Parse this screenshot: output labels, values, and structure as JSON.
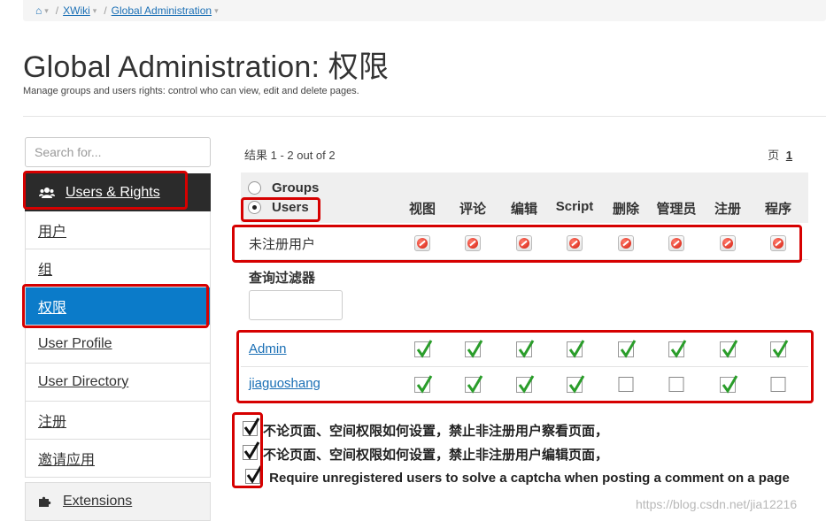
{
  "breadcrumb": {
    "home": "⌂",
    "items": [
      "XWiki",
      "Global Administration"
    ]
  },
  "page": {
    "title": "Global Administration: 权限",
    "subtitle": "Manage groups and users rights: control who can view, edit and delete pages."
  },
  "sidebar": {
    "search_placeholder": "Search for...",
    "section": "Users & Rights",
    "items": [
      "用户",
      "组",
      "权限",
      "User Profile",
      "User Directory",
      "注册",
      "邀请应用"
    ],
    "active_item": "权限",
    "extensions": "Extensions"
  },
  "main": {
    "results": "结果 1 - 2 out of 2",
    "page_label": "页",
    "page_number": "1",
    "radio_groups": "Groups",
    "radio_users": "Users",
    "selected_radio": "Users",
    "columns": [
      "视图",
      "评论",
      "编辑",
      "Script",
      "删除",
      "管理员",
      "注册",
      "程序"
    ],
    "unregistered": {
      "label": "未注册用户",
      "rights": [
        "deny",
        "deny",
        "deny",
        "deny",
        "deny",
        "deny",
        "deny",
        "deny"
      ]
    },
    "filter_label": "查询过滤器",
    "filter_value": "",
    "users": [
      {
        "name": "Admin",
        "rights": [
          "allow",
          "allow",
          "allow",
          "allow",
          "allow",
          "allow",
          "allow",
          "allow"
        ]
      },
      {
        "name": "jiaguoshang",
        "rights": [
          "allow",
          "allow",
          "allow",
          "allow",
          "none",
          "none",
          "allow",
          "none"
        ]
      }
    ],
    "options": [
      {
        "label": "不论页面、空间权限如何设置，禁止非注册用户察看页面，",
        "checked": true
      },
      {
        "label": "不论页面、空间权限如何设置，禁止非注册用户编辑页面，",
        "checked": true
      },
      {
        "label": "Require unregistered users to solve a captcha when posting a comment on a page",
        "checked": true
      }
    ]
  },
  "watermark": "https://blog.csdn.net/jia12216",
  "colors": {
    "accent": "#0b7bc9",
    "annotation": "#d60000",
    "header_dark": "#2b2b2b"
  }
}
